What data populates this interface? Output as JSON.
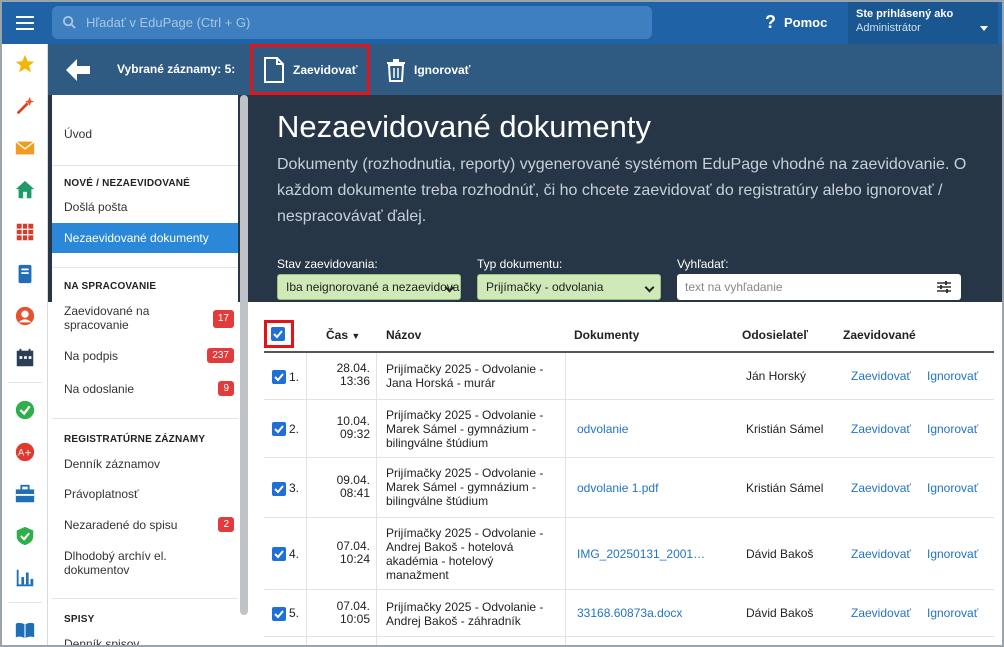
{
  "topbar": {
    "search_placeholder": "Hľadať v EduPage (Ctrl + G)",
    "help_label": "Pomoc",
    "user_line1": "Ste prihlásený ako",
    "user_line2": "Administrátor"
  },
  "toolbar": {
    "selected_label": "Vybrané záznamy: 5:",
    "register_label": "Zaevidovať",
    "ignore_label": "Ignorovať"
  },
  "nav": {
    "intro": "Úvod",
    "section_new": "NOVÉ / NEZAEVIDOVANÉ",
    "incoming": "Došlá pošta",
    "unregistered": "Nezaevidované dokumenty",
    "section_processing": "NA SPRACOVANIE",
    "registered_for_processing": "Zaevidované na spracovanie",
    "registered_for_processing_count": "17",
    "to_sign": "Na podpis",
    "to_sign_count": "237",
    "to_send": "Na odoslanie",
    "to_send_count": "9",
    "section_registry": "REGISTRATÚRNE ZÁZNAMY",
    "journal": "Denník záznamov",
    "validity": "Právoplatnosť",
    "unfiled": "Nezaradené do spisu",
    "unfiled_count": "2",
    "archive": "Dlhodobý archív el. dokumentov",
    "section_files": "SPISY",
    "files_journal": "Denník spisov"
  },
  "main": {
    "title": "Nezaevidované dokumenty",
    "description": "Dokumenty (rozhodnutia, reporty) vygenerované systémom EduPage vhodné na zaevidovanie. O každom dokumente treba rozhodnúť, či ho chcete zaevidovať do registratúry alebo ignorovať / nespracovávať ďalej."
  },
  "filters": {
    "status_label": "Stav zaevidovania:",
    "status_value": "Iba neignorované a nezaevidované",
    "type_label": "Typ dokumentu:",
    "type_value": "Prijímačky - odvolania",
    "search_label": "Vyhľadať:",
    "search_placeholder": "text na vyhľadanie"
  },
  "table": {
    "headers": {
      "time": "Čas",
      "name": "Názov",
      "documents": "Dokumenty",
      "sender": "Odosielateľ",
      "registered": "Zaevidované"
    },
    "rows": [
      {
        "num": "1.",
        "date": "28.04.",
        "time": "13:36",
        "name": "Prijímačky 2025 - Odvolanie - Jana Horská - murár",
        "doc": "",
        "sender": "Ján Horský",
        "act1": "Zaevidovať",
        "act2": "Ignorovať"
      },
      {
        "num": "2.",
        "date": "10.04.",
        "time": "09:32",
        "name": "Prijímačky 2025 - Odvolanie - Marek Sámel - gymnázium - bilingválne štúdium",
        "doc": "odvolanie",
        "sender": "Kristián Sámel",
        "act1": "Zaevidovať",
        "act2": "Ignorovať"
      },
      {
        "num": "3.",
        "date": "09.04.",
        "time": "08:41",
        "name": "Prijímačky 2025 - Odvolanie - Marek Sámel - gymnázium - bilingválne štúdium",
        "doc": "odvolanie 1.pdf",
        "sender": "Kristián Sámel",
        "act1": "Zaevidovať",
        "act2": "Ignorovať"
      },
      {
        "num": "4.",
        "date": "07.04.",
        "time": "10:24",
        "name": "Prijímačky 2025 - Odvolanie - Andrej Bakoš - hotelová akadémia - hotelový manažment",
        "doc": "IMG_20250131_2001…",
        "sender": "Dávid Bakoš",
        "act1": "Zaevidovať",
        "act2": "Ignorovať"
      },
      {
        "num": "5.",
        "date": "07.04.",
        "time": "10:05",
        "name": "Prijímačky 2025 - Odvolanie - Andrej Bakoš - záhradník",
        "doc": "33168.60873a.docx",
        "sender": "Dávid Bakoš",
        "act1": "Zaevidovať",
        "act2": "Ignorovať"
      }
    ]
  }
}
